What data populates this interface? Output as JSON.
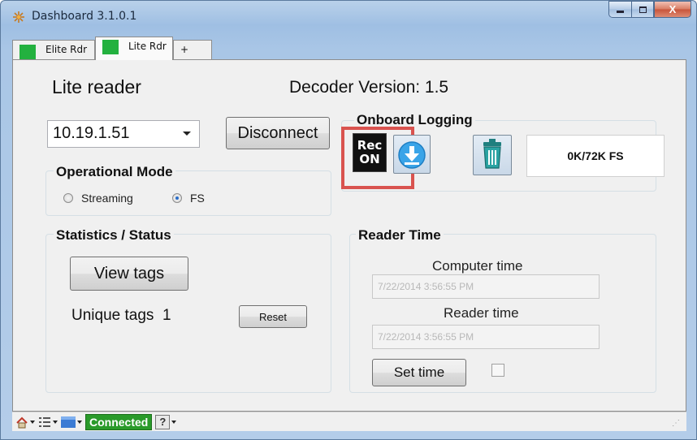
{
  "window": {
    "title": "Dashboard 3.1.0.1",
    "controls": {
      "minimize": "–",
      "maximize": "□",
      "close": "X"
    }
  },
  "tabs": [
    {
      "label": "Elite Rdr",
      "color": "#23b13f",
      "active": false
    },
    {
      "label": "Lite Rdr",
      "color": "#23b13f",
      "active": true
    },
    {
      "label": "+",
      "active": false
    }
  ],
  "main": {
    "reader_title": "Lite reader",
    "decoder_version": "Decoder Version: 1.5",
    "ip_selected": "10.19.1.51",
    "disconnect_label": "Disconnect",
    "operational_mode": {
      "title": "Operational Mode",
      "options": [
        {
          "label": "Streaming",
          "selected": false
        },
        {
          "label": "FS",
          "selected": true
        }
      ]
    },
    "onboard_logging": {
      "title": "Onboard Logging",
      "rec_line1": "Rec",
      "rec_line2": "ON",
      "download_icon": "download-icon",
      "trash_icon": "trash-icon",
      "counter": "0K/72K FS"
    },
    "statistics": {
      "title": "Statistics / Status",
      "view_tags_label": "View tags",
      "unique_tags_label": "Unique tags",
      "unique_tags_count": "1",
      "reset_label": "Reset"
    },
    "reader_time": {
      "title": "Reader Time",
      "computer_time_label": "Computer time",
      "computer_time_value": "7/22/2014 3:56:55 PM",
      "reader_time_label": "Reader time",
      "reader_time_value": "7/22/2014 3:56:55 PM",
      "set_time_label": "Set time",
      "checkbox_checked": false
    }
  },
  "statusbar": {
    "connection_status": "Connected",
    "help": "?",
    "accent_color": "#2a9a2a"
  }
}
